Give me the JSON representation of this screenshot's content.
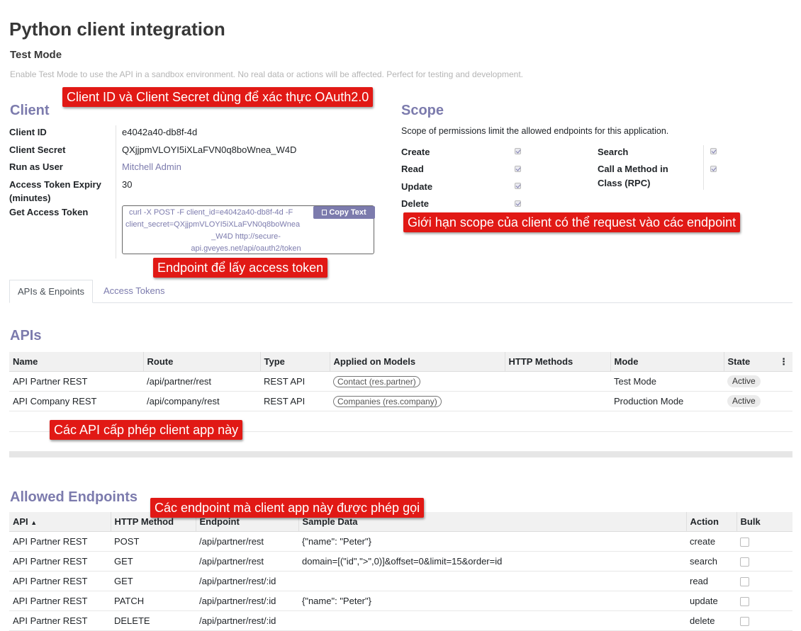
{
  "page": {
    "title": "Python client integration",
    "test_mode_title": "Test Mode",
    "test_mode_desc": "Enable Test Mode to use the API in a sandbox environment. No real data or actions will be affected. Perfect for testing and development."
  },
  "client": {
    "title": "Client",
    "fields": {
      "client_id": {
        "label": "Client ID",
        "value": "e4042a40-db8f-4d"
      },
      "client_secret": {
        "label": "Client Secret",
        "value": "QXjjpmVLOYI5iXLaFVN0q8boWnea_W4D"
      },
      "run_as_user": {
        "label": "Run as User",
        "value": "Mitchell Admin"
      },
      "expiry": {
        "label_1": "Access Token Expiry",
        "label_2": "(minutes)",
        "value": "30"
      },
      "get_token": {
        "label": "Get Access Token",
        "code_1": "curl -X POST -F client_id=e4042a40-db8f-4d -F",
        "code_2": "client_secret=QXjjpmVLOYI5iXLaFVN0q8boWnea",
        "code_3": "_W4D http://secure-",
        "code_4": "api.gveyes.net/api/oauth2/token",
        "copy_label": "Copy Text"
      }
    }
  },
  "scope": {
    "title": "Scope",
    "description": "Scope of permissions limit the allowed endpoints for this application.",
    "create": "Create",
    "read": "Read",
    "update": "Update",
    "delete": "Delete",
    "search": "Search",
    "call_method_1": "Call a Method in",
    "call_method_2": "Class (RPC)"
  },
  "annotations": {
    "client": "Client ID và Client Secret dùng để xác thực OAuth2.0",
    "scope": "Giới hạn scope của client có thể request vào các endpoint",
    "token": "Endpoint để lấy access token",
    "apis": "Các API cấp phép client app này",
    "endpoints": "Các endpoint mà client app này được phép gọi"
  },
  "tabs": {
    "apis": "APIs & Enpoints",
    "tokens": "Access Tokens"
  },
  "apis": {
    "title": "APIs",
    "headers": {
      "name": "Name",
      "route": "Route",
      "type": "Type",
      "models": "Applied on Models",
      "methods": "HTTP Methods",
      "mode": "Mode",
      "state": "State"
    },
    "rows": [
      {
        "name": "API Partner REST",
        "route": "/api/partner/rest",
        "type": "REST API",
        "models": "Contact (res.partner)",
        "methods": "",
        "mode": "Test Mode",
        "state": "Active"
      },
      {
        "name": "API Company REST",
        "route": "/api/company/rest",
        "type": "REST API",
        "models": "Companies (res.company)",
        "methods": "",
        "mode": "Production Mode",
        "state": "Active"
      }
    ]
  },
  "endpoints": {
    "title": "Allowed Endpoints",
    "headers": {
      "api": "API",
      "sort": "▲",
      "method": "HTTP Method",
      "endpoint": "Endpoint",
      "sample": "Sample Data",
      "action": "Action",
      "bulk": "Bulk"
    },
    "rows": [
      {
        "api": "API Partner REST",
        "method": "POST",
        "endpoint": "/api/partner/rest",
        "sample": "{\"name\": \"Peter\"}",
        "action": "create"
      },
      {
        "api": "API Partner REST",
        "method": "GET",
        "endpoint": "/api/partner/rest",
        "sample": "domain=[(\"id\",\">\",0)]&offset=0&limit=15&order=id",
        "action": "search"
      },
      {
        "api": "API Partner REST",
        "method": "GET",
        "endpoint": "/api/partner/rest/:id",
        "sample": "",
        "action": "read"
      },
      {
        "api": "API Partner REST",
        "method": "PATCH",
        "endpoint": "/api/partner/rest/:id",
        "sample": "{\"name\": \"Peter\"}",
        "action": "update"
      },
      {
        "api": "API Partner REST",
        "method": "DELETE",
        "endpoint": "/api/partner/rest/:id",
        "sample": "",
        "action": "delete"
      }
    ]
  }
}
